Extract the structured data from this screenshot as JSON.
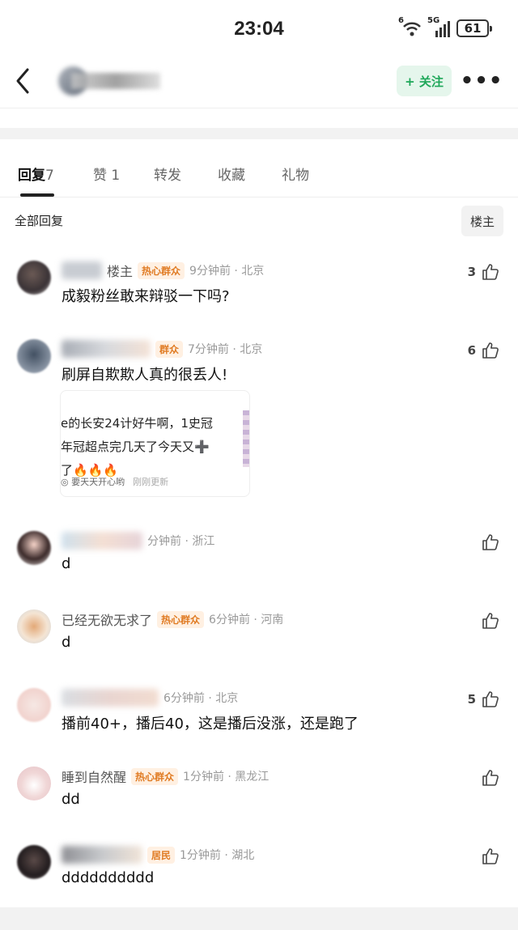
{
  "status": {
    "time": "23:04",
    "wifi_label": "6",
    "network_label": "5G",
    "battery": "61"
  },
  "header": {
    "follow_label": "+ 关注",
    "more_label": "•••"
  },
  "tabs": [
    {
      "label": "回复",
      "count": "7"
    },
    {
      "label": "赞",
      "count": "1"
    },
    {
      "label": "转发",
      "count": ""
    },
    {
      "label": "收藏",
      "count": ""
    },
    {
      "label": "礼物",
      "count": ""
    }
  ],
  "section": {
    "title": "全部回复",
    "op_button": "楼主"
  },
  "comments": [
    {
      "name": "楼主",
      "badge": "热心群众",
      "time": "9分钟前 · 北京",
      "text": "成毅粉丝敢来辩驳一下吗?",
      "likes": "3"
    },
    {
      "name": "",
      "badge": "群众",
      "time": "7分钟前 · 北京",
      "text": "刷屏自欺欺人真的很丢人!",
      "likes": "6",
      "quote": {
        "line1": "e的长安24计好牛啊，1史冠",
        "line2": "年冠超点完几天了今天又➕",
        "line3": "了🔥🔥🔥",
        "author": "要天天开心哟",
        "updated": "刚刚更新"
      }
    },
    {
      "name": "",
      "badge": "",
      "time": "分钟前 · 浙江",
      "text": "d",
      "likes": ""
    },
    {
      "name": "已经无欲无求了",
      "badge": "热心群众",
      "time": "6分钟前 · 河南",
      "text": "d",
      "likes": ""
    },
    {
      "name": "",
      "badge": "",
      "time": "6分钟前 · 北京",
      "text": "播前40+，播后40，这是播后没涨，还是跑了",
      "likes": "5"
    },
    {
      "name": "睡到自然醒",
      "badge": "热心群众",
      "time": "1分钟前 · 黑龙江",
      "text": "dd",
      "likes": ""
    },
    {
      "name": "",
      "badge": "居民",
      "time": "1分钟前 · 湖北",
      "text": "dddddddddd",
      "likes": ""
    }
  ]
}
